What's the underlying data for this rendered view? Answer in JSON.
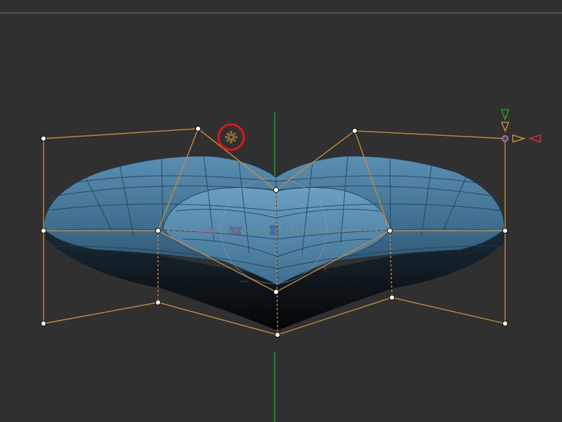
{
  "viewport": {
    "background_color": "#303030",
    "mesh_color": "#3f6f8f",
    "cage_color": "#c58a3a",
    "axis_y_color": "#1fa31f",
    "axis_x_color": "#d43030",
    "gizmo_highlight_color": "#e01515"
  },
  "icons": {
    "settings": "gear-icon",
    "move_gizmo": "move-gizmo-icon"
  }
}
